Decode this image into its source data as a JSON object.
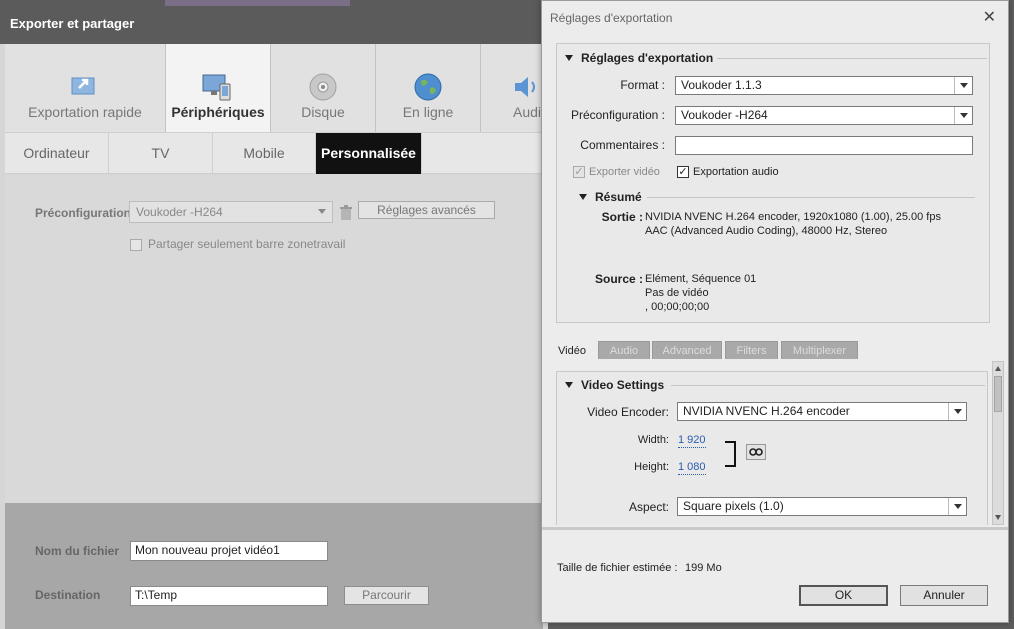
{
  "left_window": {
    "title": "Exporter et partager",
    "categories": [
      {
        "label": "Exportation rapide",
        "icon": "quick-export-icon"
      },
      {
        "label": "Périphériques",
        "icon": "devices-icon"
      },
      {
        "label": "Disque",
        "icon": "disc-icon"
      },
      {
        "label": "En ligne",
        "icon": "globe-icon"
      },
      {
        "label": "Audi",
        "icon": "speaker-icon"
      }
    ],
    "subtabs": [
      "Ordinateur",
      "TV",
      "Mobile",
      "Personnalisée"
    ],
    "preset_label": "Préconfiguration",
    "preset_value": "Voukoder -H264",
    "advanced_button": "Réglages avancés",
    "share_checkbox_label": "Partager seulement barre zonetravail",
    "filename_label": "Nom du fichier",
    "filename_value": "Mon nouveau projet vidéo1",
    "destination_label": "Destination",
    "destination_value": "T:\\Temp",
    "browse_button": "Parcourir"
  },
  "dialog": {
    "title": "Réglages d'exportation",
    "close_glyph": "✕",
    "export_section": "Réglages d'exportation",
    "format_label": "Format :",
    "format_value": "Voukoder 1.1.3",
    "preset_label": "Préconfiguration :",
    "preset_value": "Voukoder -H264",
    "comments_label": "Commentaires :",
    "comments_value": "",
    "export_video_label": "Exporter vidéo",
    "export_audio_label": "Exportation audio",
    "summary_section": "Résumé",
    "output_label": "Sortie :",
    "output_line1": "NVIDIA NVENC H.264 encoder, 1920x1080 (1.00), 25.00 fps",
    "output_line2": "AAC (Advanced Audio Coding), 48000 Hz, Stereo",
    "source_label": "Source :",
    "source_line1": "Elément, Séquence 01",
    "source_line2": "Pas de vidéo",
    "source_line3": ", 00;00;00;00",
    "tabs": [
      "Vidéo",
      "Audio",
      "Advanced",
      "Filters",
      "Multiplexer"
    ],
    "video_settings_section": "Video Settings",
    "encoder_label": "Video Encoder:",
    "encoder_value": "NVIDIA NVENC H.264 encoder",
    "width_label": "Width:",
    "width_value": "1 920",
    "height_label": "Height:",
    "height_value": "1 080",
    "aspect_label": "Aspect:",
    "aspect_value": "Square pixels (1.0)",
    "filesize_label": "Taille de fichier estimée :",
    "filesize_value": "199 Mo",
    "ok_button": "OK",
    "cancel_button": "Annuler"
  },
  "colors": {
    "titlebar": "#5b5b5b",
    "active_subtab": "#111111",
    "link": "#2a5db0"
  }
}
